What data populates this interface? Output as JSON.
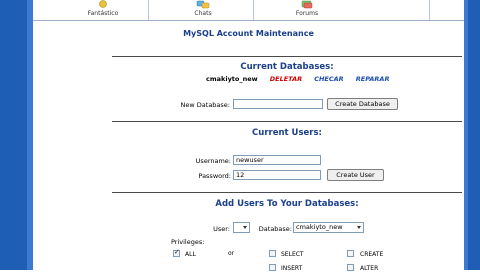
{
  "nav": {
    "tabs": [
      {
        "label": "Fantástico"
      },
      {
        "label": "Chats"
      },
      {
        "label": "Forums"
      }
    ]
  },
  "page": {
    "title": "MySQL Account Maintenance"
  },
  "databases": {
    "heading": "Current Databases:",
    "name": "cmakiyto_new",
    "actions": {
      "delete": "DELETAR",
      "check": "CHECAR",
      "repair": "REPARAR"
    },
    "new_label": "New Database:",
    "new_value": "",
    "create_button": "Create Database"
  },
  "users": {
    "heading": "Current Users:",
    "username_label": "Username:",
    "username_value": "newuser",
    "password_label": "Password:",
    "password_value": "12",
    "create_button": "Create User"
  },
  "add_users": {
    "heading": "Add Users To Your Databases:",
    "user_label": "User:",
    "user_value": "",
    "database_label": "Database:",
    "database_value": "cmakiyto_new",
    "privileges_label": "Privileges:",
    "or_label": "or",
    "privileges": {
      "all": "ALL",
      "select": "SELECT",
      "create": "CREATE",
      "insert": "INSERT",
      "alter": "ALTER"
    }
  },
  "colors": {
    "sidebar": "#1e5fb5",
    "heading": "#1a3f8c",
    "delete_link": "#cc0000",
    "link": "#1a4db8"
  }
}
